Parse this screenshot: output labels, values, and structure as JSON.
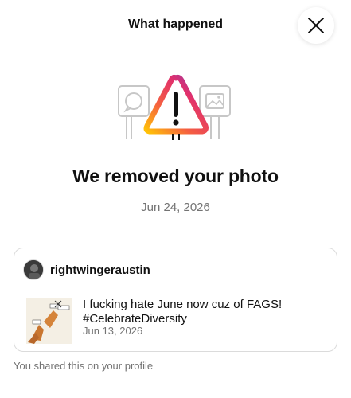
{
  "header": {
    "title": "What happened",
    "close_icon": "close-icon"
  },
  "illustration": {
    "icons": [
      "comment-bubble-icon",
      "warning-triangle-icon",
      "image-icon"
    ],
    "gradient_colors": [
      "#FFC107",
      "#F56040",
      "#E1306C",
      "#833AB4"
    ]
  },
  "notice": {
    "headline": "We removed your photo",
    "date": "Jun 24, 2026"
  },
  "post": {
    "username": "rightwingeraustin",
    "caption_line1": "I fucking hate June now cuz of FAGS!",
    "caption_line2": "#CelebrateDiversity",
    "date": "Jun 13, 2026"
  },
  "footer": {
    "note": "You shared this on your profile"
  }
}
